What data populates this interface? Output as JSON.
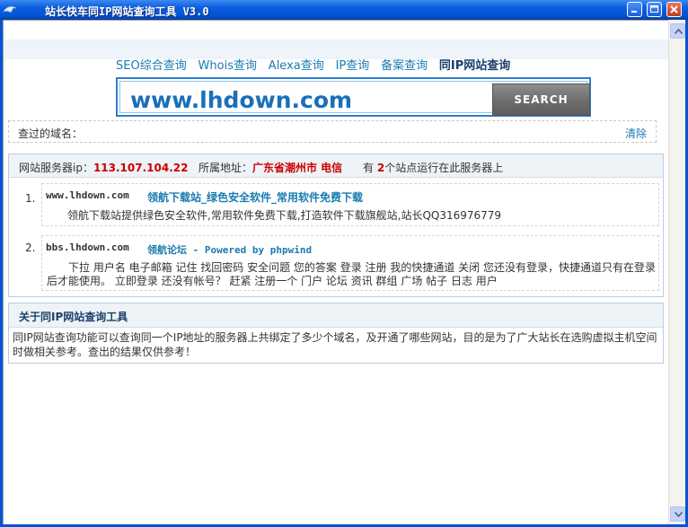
{
  "window": {
    "title": "站长快车同IP网站查询工具 V3.0"
  },
  "tabs": [
    {
      "label": "SEO综合查询"
    },
    {
      "label": "Whois查询"
    },
    {
      "label": "Alexa查询"
    },
    {
      "label": "IP查询"
    },
    {
      "label": "备案查询"
    },
    {
      "label": "同IP网站查询",
      "active": true
    }
  ],
  "search": {
    "value": "www.lhdown.com",
    "button_label": "SEARCH"
  },
  "history": {
    "label": "查过的域名：",
    "clear_label": "清除"
  },
  "results": {
    "ip_label": "网站服务器ip：",
    "ip": "113.107.104.22",
    "location_label": "所属地址：",
    "location": "广东省潮州市 电信",
    "count_prefix": "有",
    "count": "2",
    "count_suffix": "个站点运行在此服务器上",
    "items": [
      {
        "num": "1.",
        "domain": "www.lhdown.com",
        "title": "领航下载站_绿色安全软件_常用软件免费下载",
        "desc": "领航下载站提供绿色安全软件,常用软件免费下载,打造软件下载旗舰站,站长QQ316976779"
      },
      {
        "num": "2.",
        "domain": "bbs.lhdown.com",
        "title": "领航论坛 - Powered by phpwind",
        "desc": "下拉 用户名 电子邮箱 记住 找回密码 安全问题 您的答案 登录 注册 我的快捷通道 关闭 您还没有登录，快捷通道只有在登录后才能使用。 立即登录 还没有帐号？ 赶紧 注册一个 门户 论坛 资讯 群组 广场 帖子 日志 用户"
      }
    ]
  },
  "about": {
    "title": "关于同IP网站查询工具",
    "body": "同IP网站查询功能可以查询同一个IP地址的服务器上共绑定了多少个域名，及开通了哪些网站，目的是为了广大站长在选购虚拟主机空间时做相关参考。查出的结果仅供参考！"
  },
  "colors": {
    "titlebar": "#0554d6",
    "link": "#1a7bb0",
    "highlight": "#cc0000"
  }
}
